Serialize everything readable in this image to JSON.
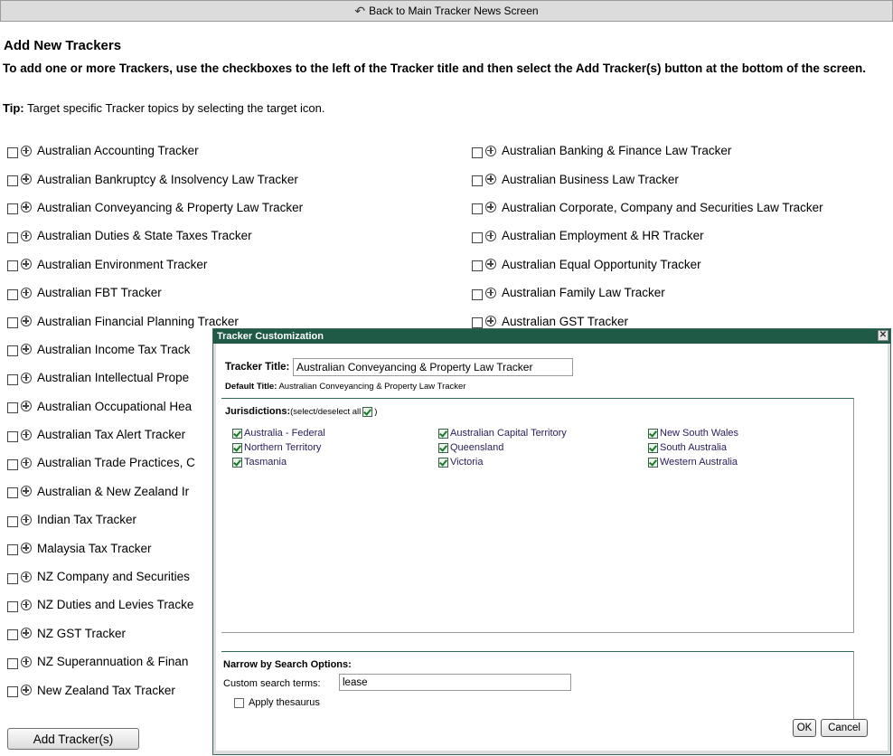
{
  "topbar": {
    "back_label": "Back to Main Tracker News Screen"
  },
  "page": {
    "title": "Add New Trackers",
    "instructions": "To add one or more Trackers, use the checkboxes to the left of the Tracker title and then select the Add Tracker(s) button at the bottom of the screen.",
    "tip_label": "Tip:",
    "tip_text": " Target specific Tracker topics by selecting the target icon."
  },
  "trackers_left": [
    "Australian Accounting Tracker",
    "Australian Bankruptcy & Insolvency Law Tracker",
    "Australian Conveyancing & Property Law Tracker",
    "Australian Duties & State Taxes Tracker",
    "Australian Environment Tracker",
    "Australian FBT Tracker",
    "Australian Financial Planning Tracker",
    "Australian Income Tax Track",
    "Australian Intellectual Prope",
    "Australian Occupational Hea",
    "Australian Tax Alert Tracker",
    "Australian Trade Practices, C",
    "Australian & New Zealand Ir",
    "Indian Tax Tracker",
    "Malaysia Tax Tracker",
    "NZ Company and Securities",
    "NZ Duties and Levies Tracke",
    "NZ GST Tracker",
    "NZ Superannuation & Finan",
    "New Zealand Tax Tracker"
  ],
  "trackers_right": [
    "Australian Banking & Finance Law Tracker",
    "Australian Business Law Tracker",
    "Australian Corporate, Company and Securities Law Tracker",
    "Australian Employment & HR Tracker",
    "Australian Equal Opportunity Tracker",
    "Australian Family Law Tracker",
    "Australian GST Tracker"
  ],
  "add_button": "Add Tracker(s)",
  "dialog": {
    "title": "Tracker Customization",
    "tracker_title_label": "Tracker Title:",
    "tracker_title_value": "Australian Conveyancing & Property Law Tracker",
    "default_title_label": "Default Title:",
    "default_title_value": " Australian Conveyancing & Property Law Tracker",
    "jurisdictions_label": "Jurisdictions:",
    "select_note": "(select/deselect all",
    "select_note_close": ")",
    "jurisdictions": [
      "Australia - Federal",
      "Australian Capital Territory",
      "New South Wales",
      "Northern Territory",
      "Queensland",
      "South Australia",
      "Tasmania",
      "Victoria",
      "Western Australia"
    ],
    "narrow_label": "Narrow by Search Options:",
    "custom_terms_label": "Custom search terms:",
    "custom_terms_value": "lease",
    "thesaurus_label": "Apply thesaurus",
    "ok_label": "OK",
    "cancel_label": "Cancel",
    "close_glyph": "✕"
  }
}
